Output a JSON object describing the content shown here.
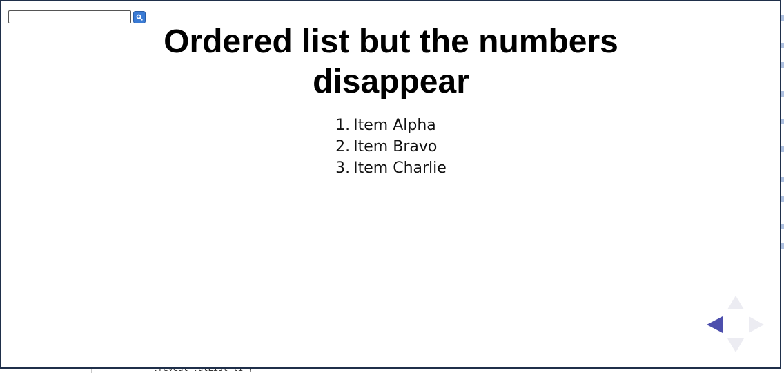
{
  "backdrop": {
    "code_snippet": ".reveal .ulList li {"
  },
  "search": {
    "value": "",
    "placeholder": "",
    "button_icon": "search-icon"
  },
  "slide": {
    "title": "Ordered list but the numbers disappear",
    "items": [
      {
        "number": "1.",
        "label": "Item Alpha"
      },
      {
        "number": "2.",
        "label": "Item Bravo"
      },
      {
        "number": "3.",
        "label": "Item Charlie"
      }
    ]
  },
  "controls": {
    "up_icon": "up-arrow-icon",
    "down_icon": "down-arrow-icon",
    "left_icon": "left-arrow-icon",
    "right_icon": "right-arrow-icon",
    "enabled_color": "#4d4fad",
    "disabled_color": "#ececf2"
  },
  "colors": {
    "frame_border": "#1f2f4a",
    "search_button": "#3a7bd5"
  }
}
